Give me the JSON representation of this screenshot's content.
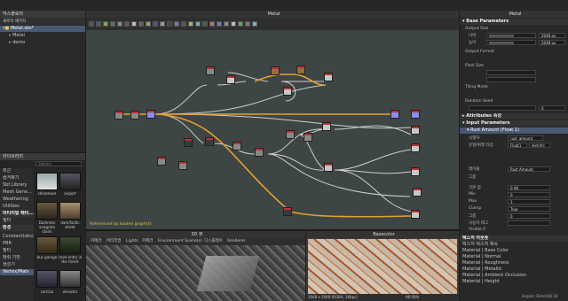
{
  "app": {
    "status": "Engine: Direct3D 10"
  },
  "explorer": {
    "title": "익스플로러",
    "tab": "새로작 패키지",
    "items": [
      {
        "label": "Metal.sbs*"
      },
      {
        "label": "Metal"
      },
      {
        "label": "demo"
      }
    ]
  },
  "library": {
    "title": "라이브러리",
    "search_placeholder": "검색하기",
    "categories": [
      {
        "label": "최근"
      },
      {
        "label": "즐겨찾기"
      },
      {
        "label": "Sbt Library"
      },
      {
        "label": "Mesh Gene..."
      },
      {
        "label": "Weathering"
      },
      {
        "label": "Utilities"
      },
      {
        "label": "머티리얼 패터..."
      },
      {
        "label": "필터"
      },
      {
        "label": "환경"
      },
      {
        "label": "Constant(sbs)"
      },
      {
        "label": "PBR"
      },
      {
        "label": "필터"
      },
      {
        "label": "메쉬 기반"
      },
      {
        "label": "생성기"
      },
      {
        "label": "Vertex/Mats"
      }
    ],
    "thumbs": [
      {
        "caption": "chinatown"
      },
      {
        "caption": "airport"
      },
      {
        "caption": "Darkness anagram stairs"
      },
      {
        "caption": "dam/factic street"
      },
      {
        "caption": "bus garage"
      },
      {
        "caption": "cave entry in the forest"
      },
      {
        "caption": "cornica"
      },
      {
        "caption": "elevator"
      }
    ]
  },
  "graph": {
    "title": "Metal",
    "footer": "Referenced by loaded graph(s)"
  },
  "view3d": {
    "title": "3D 뷰",
    "menu": [
      "카메라",
      "머티리얼",
      "Lights",
      "카메라",
      "Environment",
      "Scene(s)",
      "디스플레이",
      "Renderer"
    ]
  },
  "view2d": {
    "title": "Basecolor",
    "zoom": "98.00%",
    "info": "2048 x 2048 (RGBA, 16bpc)"
  },
  "properties": {
    "title": "Metal",
    "base_header": "Base Parameters",
    "output_size_label": "Output Size",
    "width_label": "너비",
    "height_label": "높이",
    "width_value": "2048 px",
    "height_value": "2048 px",
    "output_format_label": "Output Format",
    "pixel_size_label": "Pixel Size",
    "tiling_label": "Tiling Mode",
    "seed_label": "Random Seed",
    "seed_value": "0",
    "attributes_header": "Attributes 속성",
    "input_header": "Input Parameters",
    "rust_header": "Rust Amount (Float 1)",
    "fields": [
      {
        "label": "식별자",
        "value": "rust_amount"
      },
      {
        "label": "유형/위젯 타입",
        "value": "Float1",
        "value2": "슬라이더"
      },
      {
        "label": "레이블",
        "value": "Rust Amount"
      },
      {
        "label": "그룹",
        "value": ""
      },
      {
        "label": "기본 값",
        "value": "0.48"
      },
      {
        "label": "Min",
        "value": "0"
      },
      {
        "label": "Max",
        "value": "1"
      },
      {
        "label": "Clamp",
        "value": "True"
      },
      {
        "label": "그룹",
        "value": "0"
      },
      {
        "label": "사용자 태그",
        "value": ""
      },
      {
        "label": "Visible if",
        "value": ""
      }
    ],
    "outputs_header": "텍스처 아웃풋",
    "outputs_sub": "텍스처 텍스처 제목",
    "outputs": [
      {
        "label": "Material | Base Color"
      },
      {
        "label": "Material | Normal"
      },
      {
        "label": "Material | Roughness"
      },
      {
        "label": "Material | Metallic"
      },
      {
        "label": "Material | Ambient Occlusion"
      },
      {
        "label": "Material | Height"
      }
    ]
  }
}
